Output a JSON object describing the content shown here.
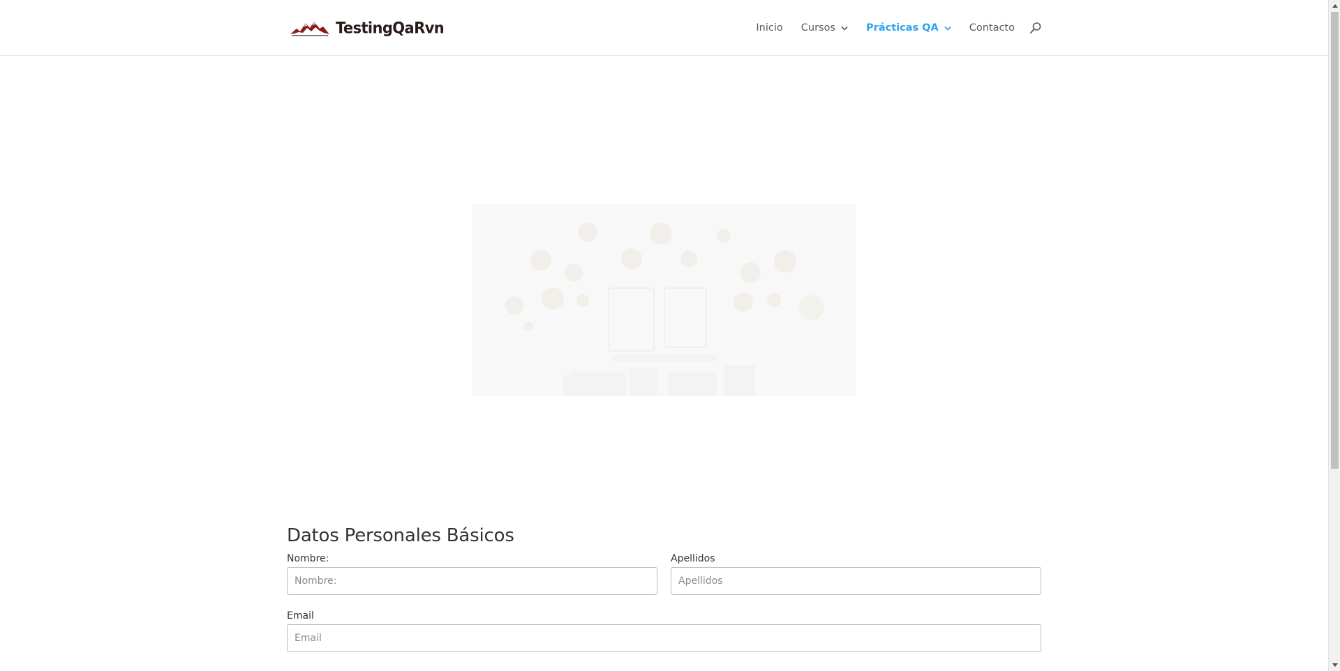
{
  "header": {
    "logo_text": "TestingQaRvn",
    "logo_icon": "mountain-icon",
    "nav": [
      {
        "label": "Inicio",
        "has_dropdown": false,
        "active": false
      },
      {
        "label": "Cursos",
        "has_dropdown": true,
        "active": false
      },
      {
        "label": "Prácticas QA",
        "has_dropdown": true,
        "active": true
      },
      {
        "label": "Contacto",
        "has_dropdown": false,
        "active": false
      }
    ],
    "search_icon": "search-icon"
  },
  "colors": {
    "accent": "#2ea3f2",
    "nav_text": "#5a5a5a",
    "logo_red": "#8b1a1a",
    "hero_bg": "#f8f8f8"
  },
  "form": {
    "title": "Datos Personales Básicos",
    "fields": {
      "nombre": {
        "label": "Nombre:",
        "placeholder": "Nombre:",
        "value": ""
      },
      "apellidos": {
        "label": "Apellidos",
        "placeholder": "Apellidos",
        "value": ""
      },
      "email": {
        "label": "Email",
        "placeholder": "Email",
        "value": ""
      }
    }
  }
}
